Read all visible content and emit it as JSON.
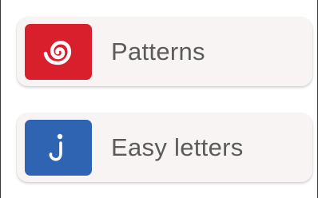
{
  "menu": {
    "items": [
      {
        "label": "Patterns",
        "icon": "spiral-icon",
        "tile_color": "#d81f2b"
      },
      {
        "label": "Easy letters",
        "icon": "letter-j-icon",
        "tile_color": "#2f64b3"
      }
    ]
  },
  "colors": {
    "card_background": "#f8f4f3",
    "label_text": "#5b5b5b"
  }
}
